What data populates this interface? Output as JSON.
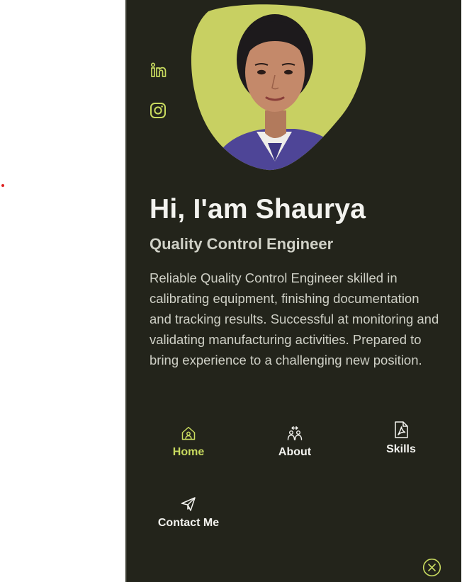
{
  "colors": {
    "accent": "#c8da5f",
    "panel_bg": "#23241b",
    "heading": "#f3f3ef",
    "body_text": "#cfd0c6"
  },
  "social": [
    {
      "icon": "linkedin-icon"
    },
    {
      "icon": "instagram-icon"
    }
  ],
  "profile": {
    "greeting": "Hi, I'am Shaurya",
    "role": "Quality Control Engineer",
    "bio": "Reliable Quality Control Engineer skilled in calibrating equipment, finishing documentation and tracking results. Successful at monitoring and validating manufacturing activities. Prepared to bring experience to a challenging new position."
  },
  "nav": {
    "home": {
      "label": "Home",
      "icon": "home-icon",
      "active": true
    },
    "about": {
      "label": "About",
      "icon": "users-icon"
    },
    "skills": {
      "label": "Skills",
      "icon": "pdf-file-icon"
    },
    "contact": {
      "label": "Contact Me",
      "icon": "send-icon"
    }
  },
  "close": {
    "icon": "close-icon"
  }
}
